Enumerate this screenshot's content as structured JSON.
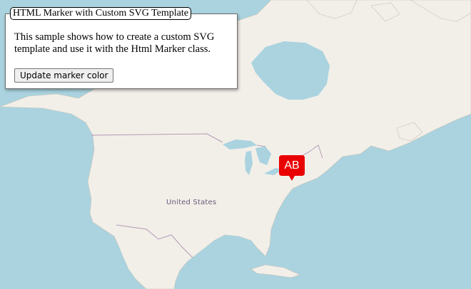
{
  "panel": {
    "legend": "HTML Marker with Custom SVG Template",
    "description": "This sample shows how to create a custom SVG template and use it with the Html Marker class.",
    "button_label": "Update marker color"
  },
  "map": {
    "country_label": "United States",
    "water_color": "#aad3df",
    "land_color": "#f2efe9",
    "border_color": "#b39bb6"
  },
  "marker": {
    "text": "AB",
    "color": "#e90000",
    "text_color": "#ffffff",
    "icon": "map-pin-icon"
  }
}
